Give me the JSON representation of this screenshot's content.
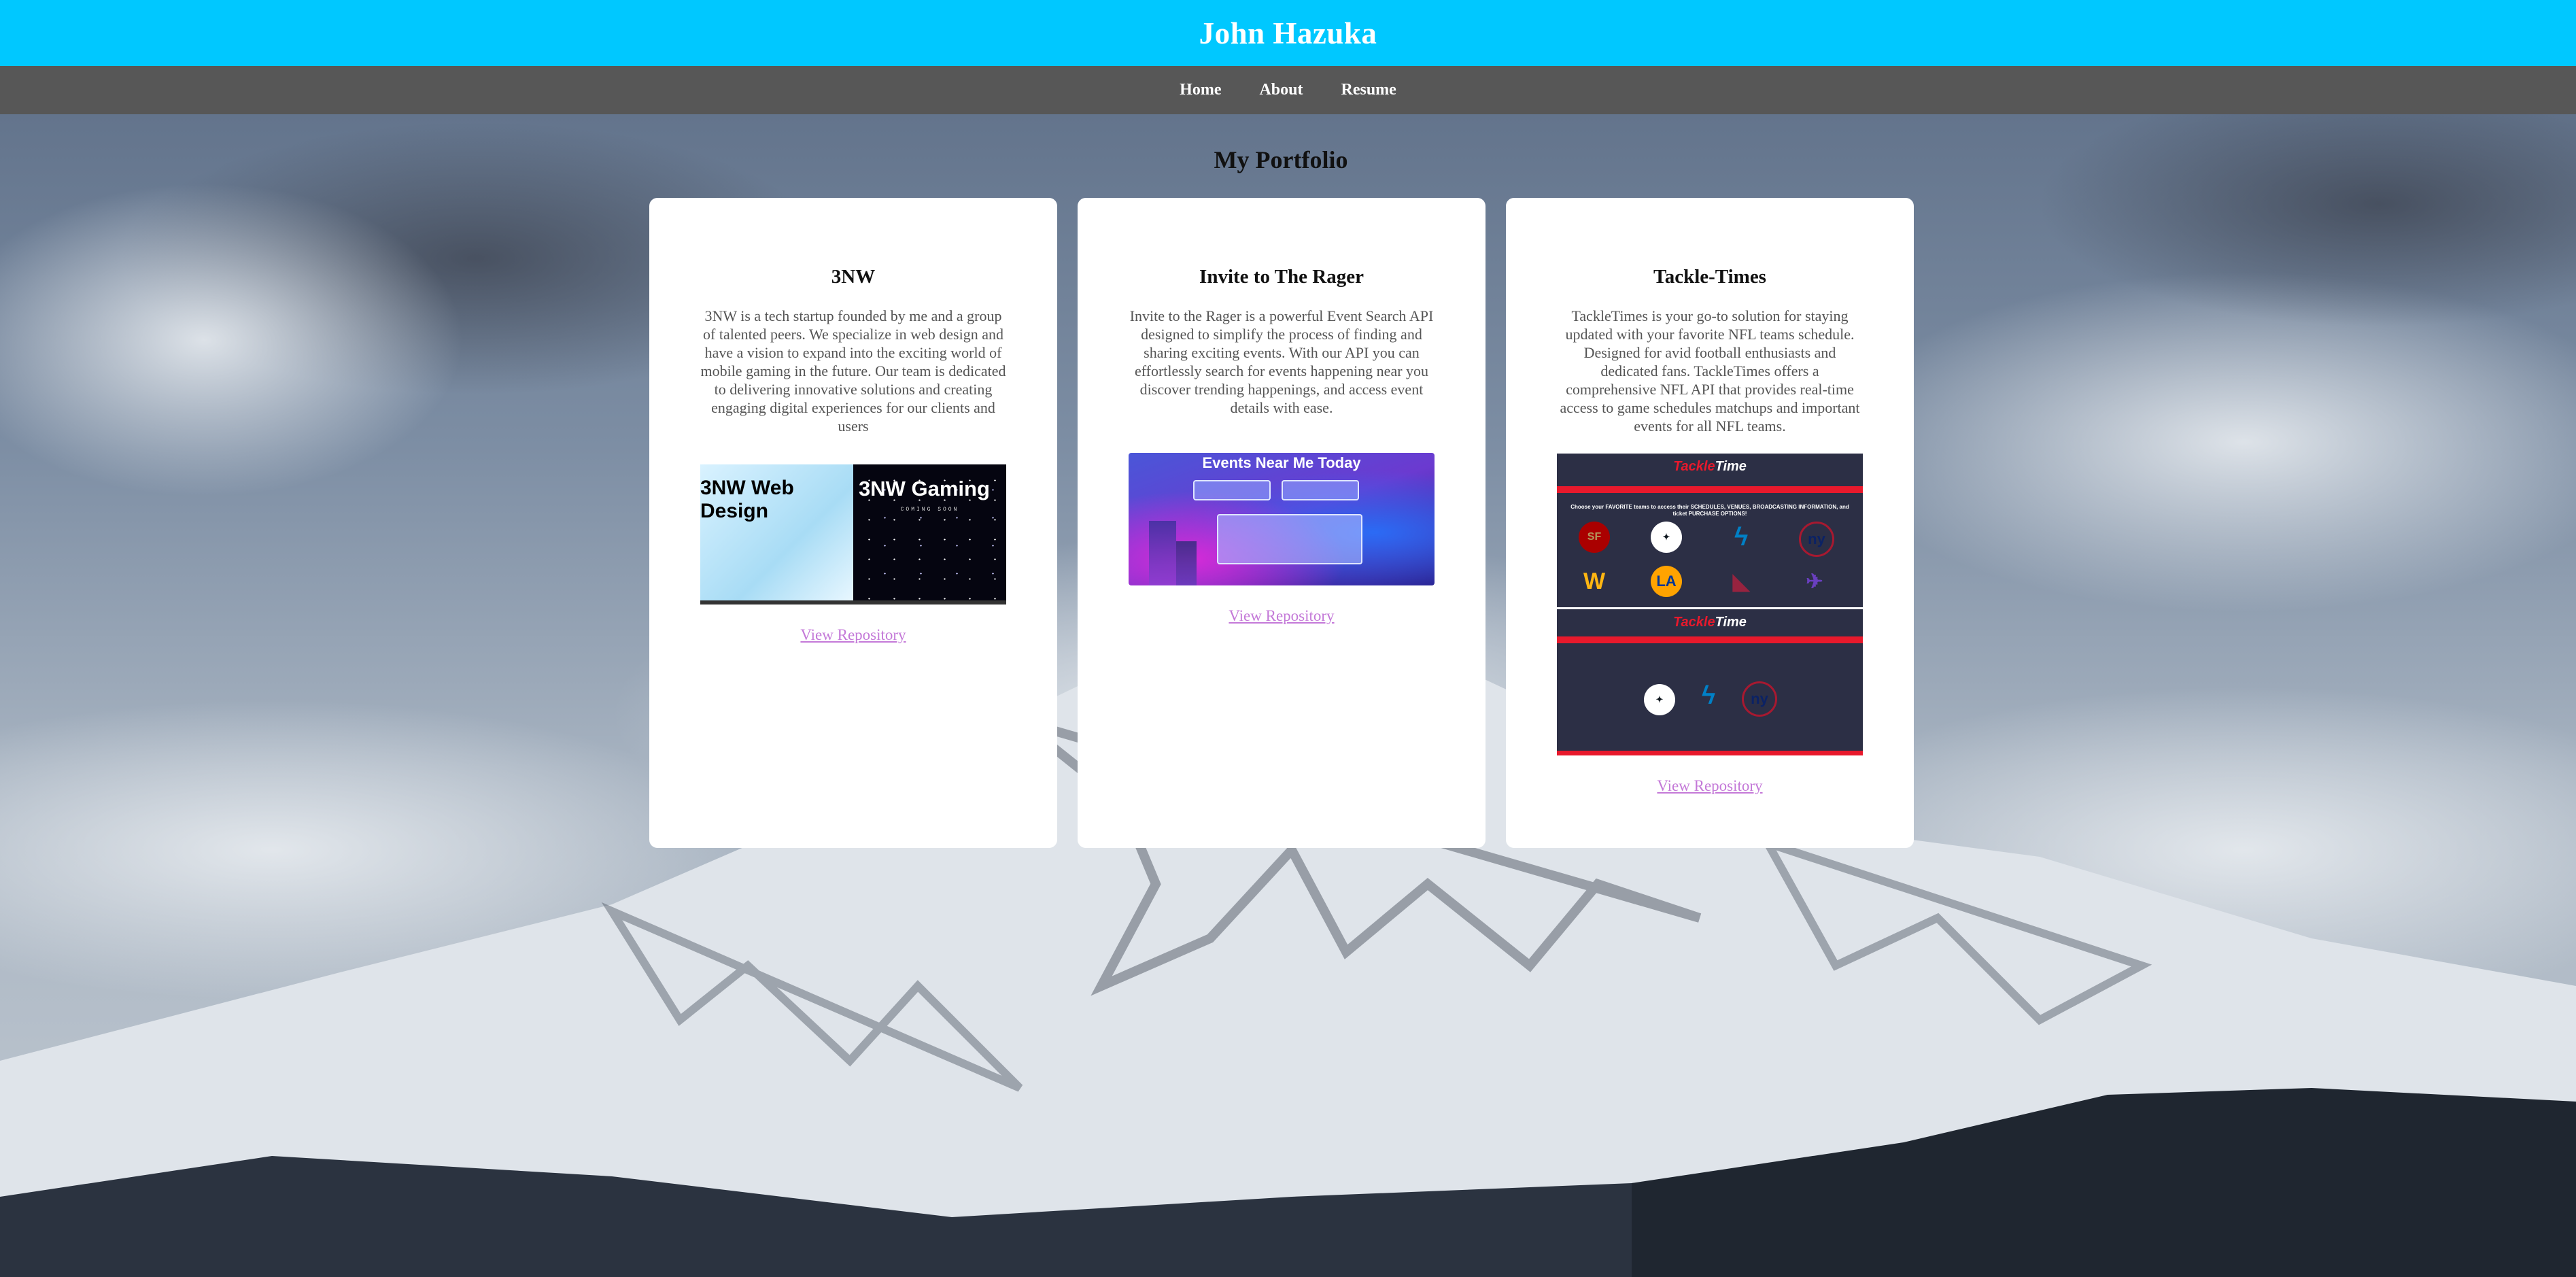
{
  "header": {
    "title": "John Hazuka"
  },
  "nav": {
    "items": [
      {
        "label": "Home"
      },
      {
        "label": "About"
      },
      {
        "label": "Resume"
      }
    ]
  },
  "portfolio": {
    "title": "My Portfolio",
    "projects": [
      {
        "title": "3NW",
        "description": "3NW is a tech startup founded by me and a group of talented peers. We specialize in web design and have a vision to expand into the exciting world of mobile gaming in the future. Our team is dedicated to delivering innovative solutions and creating engaging digital experiences for our clients and users",
        "image": {
          "left_caption": "3NW Web Design",
          "right_caption": "3NW Gaming",
          "right_subcaption": "COMING SOON"
        },
        "link": "View Repository"
      },
      {
        "title": "Invite to The Rager",
        "description": "Invite to the Rager is a powerful Event Search API designed to simplify the process of finding and sharing exciting events. With our API you can effortlessly search for events happening near you discover trending happenings, and access event details with ease.",
        "image": {
          "heading": "Events Near Me Today"
        },
        "link": "View Repository"
      },
      {
        "title": "Tackle-Times",
        "description": "TackleTimes is your go-to solution for staying updated with your favorite NFL teams schedule. Designed for avid football enthusiasts and dedicated fans. TackleTimes offers a comprehensive NFL API that provides real-time access to game schedules matchups and important events for all NFL teams.",
        "image": {
          "logo_part1": "Tackle",
          "logo_part2": "Time",
          "note": "Choose your FAVORITE teams to access their SCHEDULES, VENUES, BROADCASTING INFORMATION, and ticket PURCHASE OPTIONS!"
        },
        "link": "View Repository"
      }
    ]
  },
  "colors": {
    "header": "#00c8ff",
    "nav": "#575757",
    "card": "#ffffff",
    "link": "#c479d8"
  }
}
